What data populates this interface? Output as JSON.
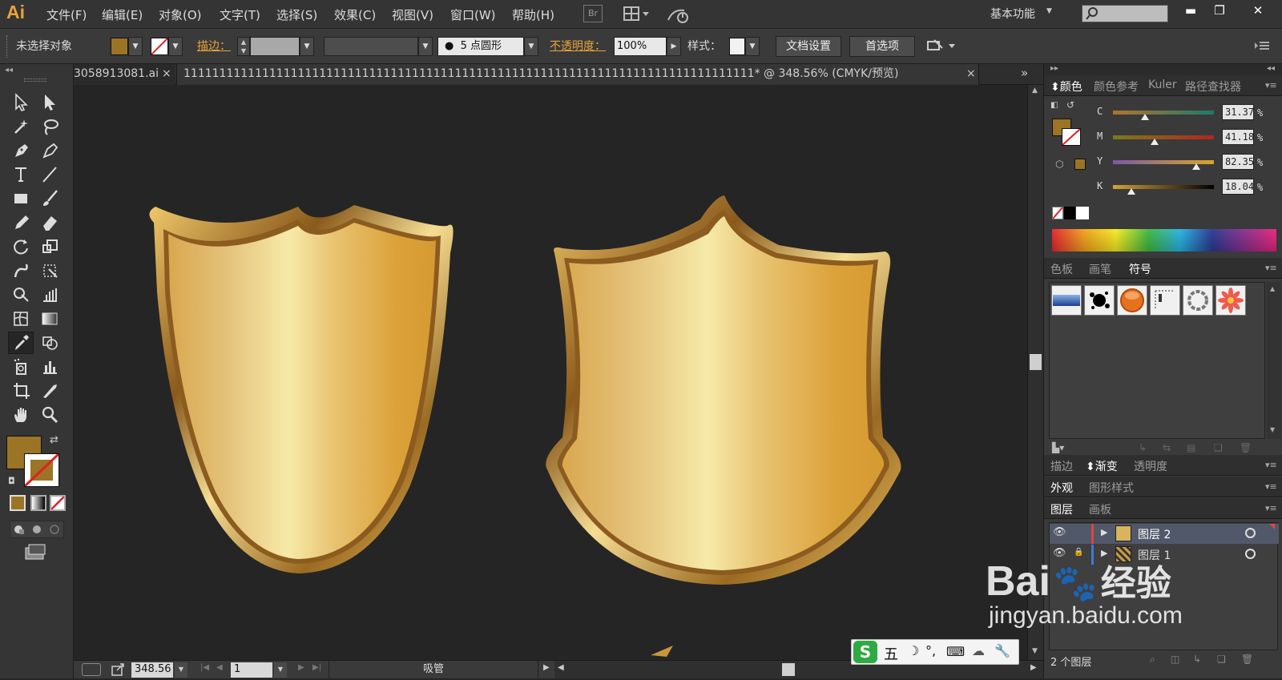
{
  "app": {
    "logo": "Ai",
    "workspace": "基本功能",
    "bridge_label": "Br"
  },
  "menu": [
    "文件(F)",
    "编辑(E)",
    "对象(O)",
    "文字(T)",
    "选择(S)",
    "效果(C)",
    "视图(V)",
    "窗口(W)",
    "帮助(H)"
  ],
  "window_controls": {
    "minimize": "▬",
    "restore": "❐",
    "close": "✕"
  },
  "control_bar": {
    "selection_status": "未选择对象",
    "stroke_label": "描边：",
    "brush_label": "5 点圆形",
    "opacity_label": "不透明度：",
    "opacity_value": "100%",
    "style_label": "样式：",
    "doc_setup_button": "文档设置",
    "preferences_button": "首选项",
    "fill_color": "#9b7426"
  },
  "document_tabs": [
    {
      "label": "3058913081.ai",
      "close": "×",
      "active": false
    },
    {
      "label": "11111111111111111111111111111111111111111111111111111111111111111111111111111111* @ 348.56% (CMYK/预览)",
      "close": "×",
      "active": true
    }
  ],
  "tabbar_expand": "»",
  "status_bar": {
    "zoom": "348.56",
    "artboard": "1",
    "tool": "吸管"
  },
  "color_panel": {
    "tabs": [
      "颜色",
      "颜色参考",
      "Kuler",
      "路径查找器"
    ],
    "active_tab": "颜色",
    "channels": [
      {
        "label": "C",
        "value": "31.37",
        "unit": "%",
        "level": 0.314
      },
      {
        "label": "M",
        "value": "41.18",
        "unit": "%",
        "level": 0.412
      },
      {
        "label": "Y",
        "value": "82.35",
        "unit": "%",
        "level": 0.824
      },
      {
        "label": "K",
        "value": "18.04",
        "unit": "%",
        "level": 0.18
      }
    ],
    "fill_color": "#9b7426"
  },
  "swatch_panel": {
    "tabs": [
      "色板",
      "画笔",
      "符号"
    ],
    "active_tab": "符号",
    "symbols": [
      "blue-banner",
      "ink-splash",
      "orange-sphere",
      "dotted-frame",
      "chain-ring",
      "red-flower"
    ]
  },
  "stroke_panel": {
    "tabs": [
      "描边",
      "渐变",
      "透明度"
    ],
    "active_tab": "渐变"
  },
  "appearance_panel": {
    "tabs": [
      "外观",
      "图形样式"
    ],
    "active_tab": "外观"
  },
  "layers_panel": {
    "tabs": [
      "图层",
      "画板"
    ],
    "active_tab": "图层",
    "layers": [
      {
        "name": "图层 2",
        "selected": true
      },
      {
        "name": "图层 1",
        "selected": false
      }
    ],
    "footer": "2 个图层"
  },
  "ime_bar": {
    "mode": "五"
  },
  "watermark": {
    "brand": "Bai",
    "brand_suffix": "经验",
    "url": "jingyan.baidu.com"
  }
}
